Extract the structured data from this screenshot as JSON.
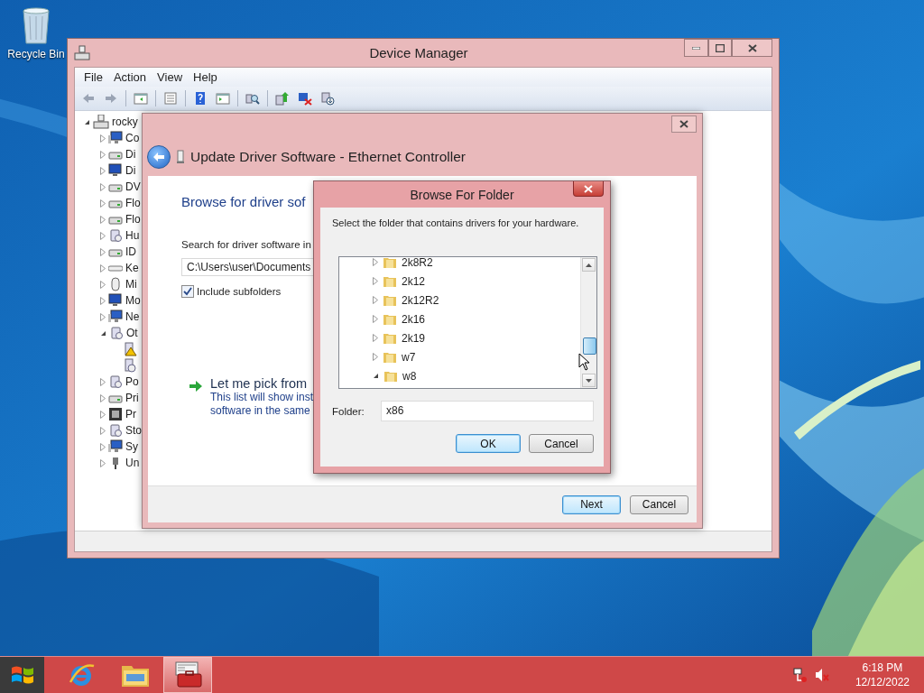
{
  "desktop": {
    "icons": [
      {
        "label": "Recycle Bin"
      }
    ]
  },
  "device_manager": {
    "title": "Device Manager",
    "menu": [
      "File",
      "Action",
      "View",
      "Help"
    ],
    "tree": {
      "label": "rocky",
      "expanded": true,
      "children": [
        {
          "label": "Co",
          "kind": "computer",
          "expanded": false
        },
        {
          "label": "Di",
          "kind": "drive",
          "expanded": false
        },
        {
          "label": "Di",
          "kind": "monitor",
          "expanded": false
        },
        {
          "label": "DV",
          "kind": "drive",
          "expanded": false
        },
        {
          "label": "Flo",
          "kind": "drive",
          "expanded": false
        },
        {
          "label": "Flo",
          "kind": "drive",
          "expanded": false
        },
        {
          "label": "Hu",
          "kind": "device",
          "expanded": false
        },
        {
          "label": "ID",
          "kind": "drive",
          "expanded": false
        },
        {
          "label": "Ke",
          "kind": "keyboard",
          "expanded": false
        },
        {
          "label": "Mi",
          "kind": "mouse",
          "expanded": false
        },
        {
          "label": "Mo",
          "kind": "monitor",
          "expanded": false
        },
        {
          "label": "Ne",
          "kind": "computer",
          "expanded": false
        },
        {
          "label": "Ot",
          "kind": "device",
          "expanded": true,
          "children": [
            {
              "warning": true
            },
            {
              "warning": false
            }
          ]
        },
        {
          "label": "Po",
          "kind": "device",
          "expanded": false
        },
        {
          "label": "Pri",
          "kind": "drive",
          "expanded": false
        },
        {
          "label": "Pr",
          "kind": "chip",
          "expanded": false
        },
        {
          "label": "Sto",
          "kind": "device",
          "expanded": false
        },
        {
          "label": "Sy",
          "kind": "computer",
          "expanded": false
        },
        {
          "label": "Un",
          "kind": "usb",
          "expanded": false
        }
      ]
    }
  },
  "update_driver": {
    "title": "Update Driver Software - Ethernet Controller",
    "heading": "Browse for driver sof",
    "search_label": "Search for driver software in",
    "path": "C:\\Users\\user\\Documents",
    "include_subfolders": {
      "label": "Include subfolders",
      "checked": true
    },
    "option": {
      "title": "Let me pick from",
      "description": [
        "This list will show inst",
        "software in the same"
      ]
    },
    "buttons": [
      {
        "label": "Next",
        "default": true
      },
      {
        "label": "Cancel",
        "default": false
      }
    ]
  },
  "browse_folder": {
    "title": "Browse For Folder",
    "instruction": "Select the folder that contains drivers for your hardware.",
    "folders": [
      {
        "name": "2k8R2",
        "expanded": false
      },
      {
        "name": "2k12",
        "expanded": false
      },
      {
        "name": "2k12R2",
        "expanded": false
      },
      {
        "name": "2k16",
        "expanded": false
      },
      {
        "name": "2k19",
        "expanded": false
      },
      {
        "name": "w7",
        "expanded": false
      },
      {
        "name": "w8",
        "expanded": true
      }
    ],
    "folder_label": "Folder:",
    "folder_value": "x86",
    "buttons": [
      {
        "label": "OK",
        "default": true
      },
      {
        "label": "Cancel",
        "default": false
      }
    ]
  },
  "taskbar": {
    "apps": [
      {
        "kind": "browser",
        "active": false
      },
      {
        "kind": "explorer",
        "active": false
      },
      {
        "kind": "toolbox",
        "active": true
      }
    ],
    "clock": {
      "time": "6:18 PM",
      "date": "12/12/2022"
    }
  }
}
